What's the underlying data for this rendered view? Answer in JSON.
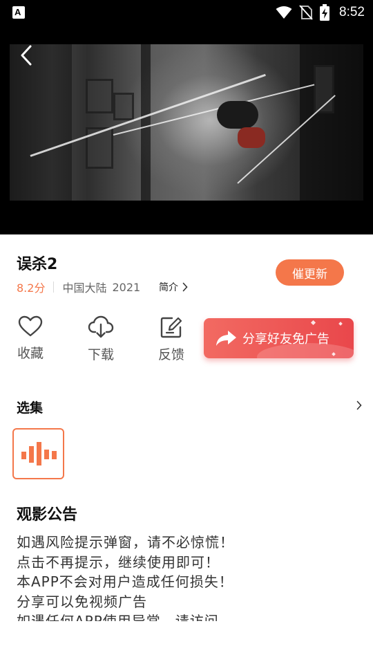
{
  "status_bar": {
    "time": "8:52",
    "app_badge": "A",
    "icons": [
      "wifi-icon",
      "no-sim-icon",
      "battery-charging-icon"
    ]
  },
  "video": {
    "back_icon": "chevron-left-icon"
  },
  "movie": {
    "title": "误杀2",
    "score": "8.2分",
    "region": "中国大陆",
    "year": "2021",
    "intro_label": "简介"
  },
  "urge_update_label": "催更新",
  "actions": {
    "favorite": {
      "label": "收藏",
      "icon": "heart-icon"
    },
    "download": {
      "label": "下载",
      "icon": "cloud-download-icon"
    },
    "feedback": {
      "label": "反馈",
      "icon": "edit-icon"
    }
  },
  "share_banner": {
    "label": "分享好友免广告",
    "icon": "share-arrow-icon"
  },
  "episodes": {
    "title": "选集",
    "more_icon": "chevron-right-icon",
    "current_icon": "playing-bars-icon"
  },
  "notice": {
    "title": "观影公告",
    "lines": [
      "如遇风险提示弹窗，请不必惊慌！",
      "点击不再提示，继续使用即可！",
      "本APP不会对用户造成任何损失！",
      "分享可以免视频广告",
      "如遇任何APP使用异常，请访问"
    ]
  },
  "colors": {
    "accent": "#f4774a",
    "share_banner": "#e9474b",
    "text_primary": "#111111",
    "text_secondary": "#666666"
  }
}
